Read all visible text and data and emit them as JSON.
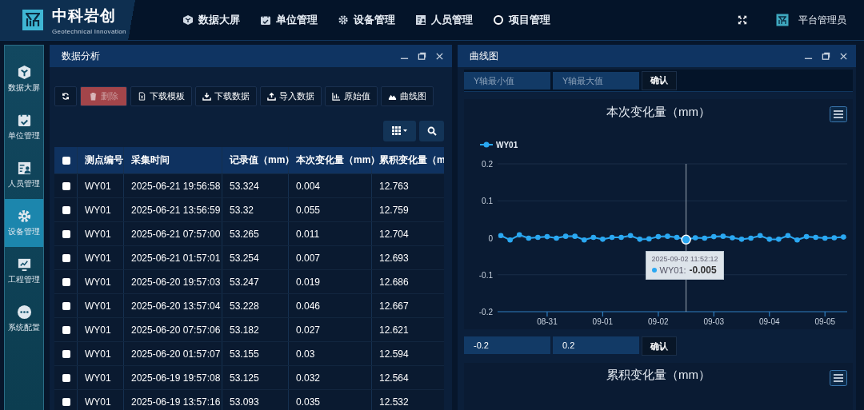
{
  "header": {
    "brand": "中科岩创",
    "subtitle": "Geotechnical Innovation",
    "nav": [
      {
        "label": "数据大屏"
      },
      {
        "label": "单位管理"
      },
      {
        "label": "设备管理"
      },
      {
        "label": "人员管理"
      },
      {
        "label": "项目管理"
      }
    ],
    "user": "平台管理员"
  },
  "sidebar": {
    "items": [
      {
        "label": "数据大屏",
        "selected": false
      },
      {
        "label": "单位管理",
        "selected": false
      },
      {
        "label": "人员管理",
        "selected": false
      },
      {
        "label": "设备管理",
        "selected": true
      },
      {
        "label": "工程管理",
        "selected": false
      },
      {
        "label": "系统配置",
        "selected": false
      }
    ]
  },
  "analysis_panel": {
    "title": "数据分析",
    "toolbar": [
      {
        "kind": "refresh",
        "disabled": false
      },
      {
        "kind": "danger",
        "label": "删除",
        "disabled": true
      },
      {
        "kind": "default",
        "label": "下载模板",
        "disabled": false
      },
      {
        "kind": "default",
        "label": "下载数据",
        "disabled": false
      },
      {
        "kind": "default",
        "label": "导入数据",
        "disabled": false
      },
      {
        "kind": "default",
        "label": "原始值",
        "disabled": false
      },
      {
        "kind": "default",
        "label": "曲线图",
        "disabled": false
      }
    ],
    "table": {
      "header_checked": false,
      "columns": [
        "测点编号",
        "采集时间",
        "记录值（mm）",
        "本次变化量（mm）",
        "累积变化量（m"
      ],
      "rows": [
        {
          "checked": false,
          "cells": [
            "WY01",
            "2025-06-21 19:56:58",
            "53.324",
            "0.004",
            "12.763"
          ]
        },
        {
          "checked": false,
          "cells": [
            "WY01",
            "2025-06-21 13:56:59",
            "53.32",
            "0.055",
            "12.759"
          ]
        },
        {
          "checked": false,
          "cells": [
            "WY01",
            "2025-06-21 07:57:00",
            "53.265",
            "0.011",
            "12.704"
          ]
        },
        {
          "checked": false,
          "cells": [
            "WY01",
            "2025-06-21 01:57:01",
            "53.254",
            "0.007",
            "12.693"
          ]
        },
        {
          "checked": false,
          "cells": [
            "WY01",
            "2025-06-20 19:57:03",
            "53.247",
            "0.019",
            "12.686"
          ]
        },
        {
          "checked": false,
          "cells": [
            "WY01",
            "2025-06-20 13:57:04",
            "53.228",
            "0.046",
            "12.667"
          ]
        },
        {
          "checked": false,
          "cells": [
            "WY01",
            "2025-06-20 07:57:06",
            "53.182",
            "0.027",
            "12.621"
          ]
        },
        {
          "checked": false,
          "cells": [
            "WY01",
            "2025-06-20 01:57:07",
            "53.155",
            "0.03",
            "12.594"
          ]
        },
        {
          "checked": false,
          "cells": [
            "WY01",
            "2025-06-19 19:57:08",
            "53.125",
            "0.032",
            "12.564"
          ]
        },
        {
          "checked": false,
          "cells": [
            "WY01",
            "2025-06-19 13:57:16",
            "53.093",
            "0.035",
            "12.532"
          ]
        }
      ]
    }
  },
  "chart_panel": {
    "title": "曲线图",
    "range_1": {
      "min_placeholder": "Y轴最小值",
      "max_placeholder": "Y轴最大值",
      "confirm": "确认"
    },
    "chart_1": {
      "tooltip": {
        "time": "2025-09-02 11:52:12",
        "series": "WY01:",
        "value": "-0.005"
      },
      "chart_data": {
        "type": "line",
        "title": "本次变化量（mm）",
        "categories": [
          null,
          null,
          null,
          null,
          null,
          "08-31",
          null,
          null,
          null,
          null,
          null,
          "09-01",
          null,
          null,
          null,
          null,
          null,
          "09-02",
          null,
          null,
          null,
          null,
          null,
          "09-03",
          null,
          null,
          null,
          null,
          null,
          "09-04",
          null,
          null,
          null,
          null,
          null,
          "09-05",
          null,
          null
        ],
        "grid": true,
        "series": [
          {
            "name": "WY01",
            "color": "#2aa8f2",
            "marker": true,
            "values": [
              0.006,
              -0.006,
              0.008,
              -0.001,
              0.001,
              0.003,
              -0.001,
              0.004,
              0.004,
              -0.006,
              0.001,
              -0.004,
              0.001,
              0.001,
              0.006,
              -0.004,
              -0.003,
              0.003,
              0.004,
              0.001,
              -0.005,
              0,
              -0.001,
              0.003,
              0.004,
              0,
              -0.004,
              -0.001,
              0.006,
              -0.004,
              -0.004,
              0.006,
              -0.006,
              0.003,
              0.001,
              -0.001,
              0,
              0.002
            ]
          }
        ],
        "ylim": [
          -0.2,
          0.2
        ],
        "yticks": [
          -0.2,
          -0.1,
          0,
          0.1,
          0.2
        ]
      }
    },
    "range_2": {
      "min_value": "-0.2",
      "max_value": "0.2",
      "confirm": "确认"
    },
    "chart_2": {
      "title": "累积变化量（mm）"
    }
  }
}
